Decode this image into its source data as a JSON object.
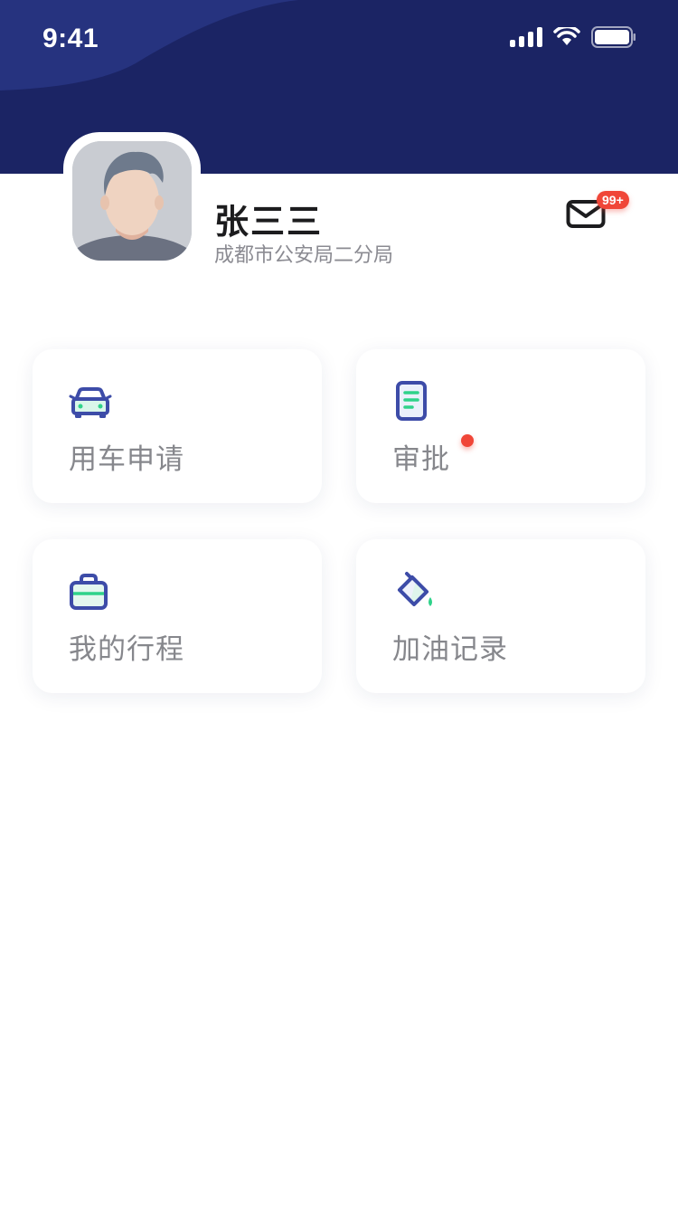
{
  "status_bar": {
    "time": "9:41"
  },
  "profile": {
    "name": "张三三",
    "organization": "成都市公安局二分局"
  },
  "messages": {
    "badge": "99+"
  },
  "colors": {
    "header": "#1b2464",
    "accent": "#3d4ca8",
    "green": "#2fd28a",
    "badge": "#f04638"
  },
  "menu": [
    {
      "label": "用车申请",
      "icon": "car-icon"
    },
    {
      "label": "审批",
      "icon": "document-icon",
      "has_notification": true
    },
    {
      "label": "我的行程",
      "icon": "bag-icon"
    },
    {
      "label": "加油记录",
      "icon": "paint-bucket-icon"
    }
  ]
}
